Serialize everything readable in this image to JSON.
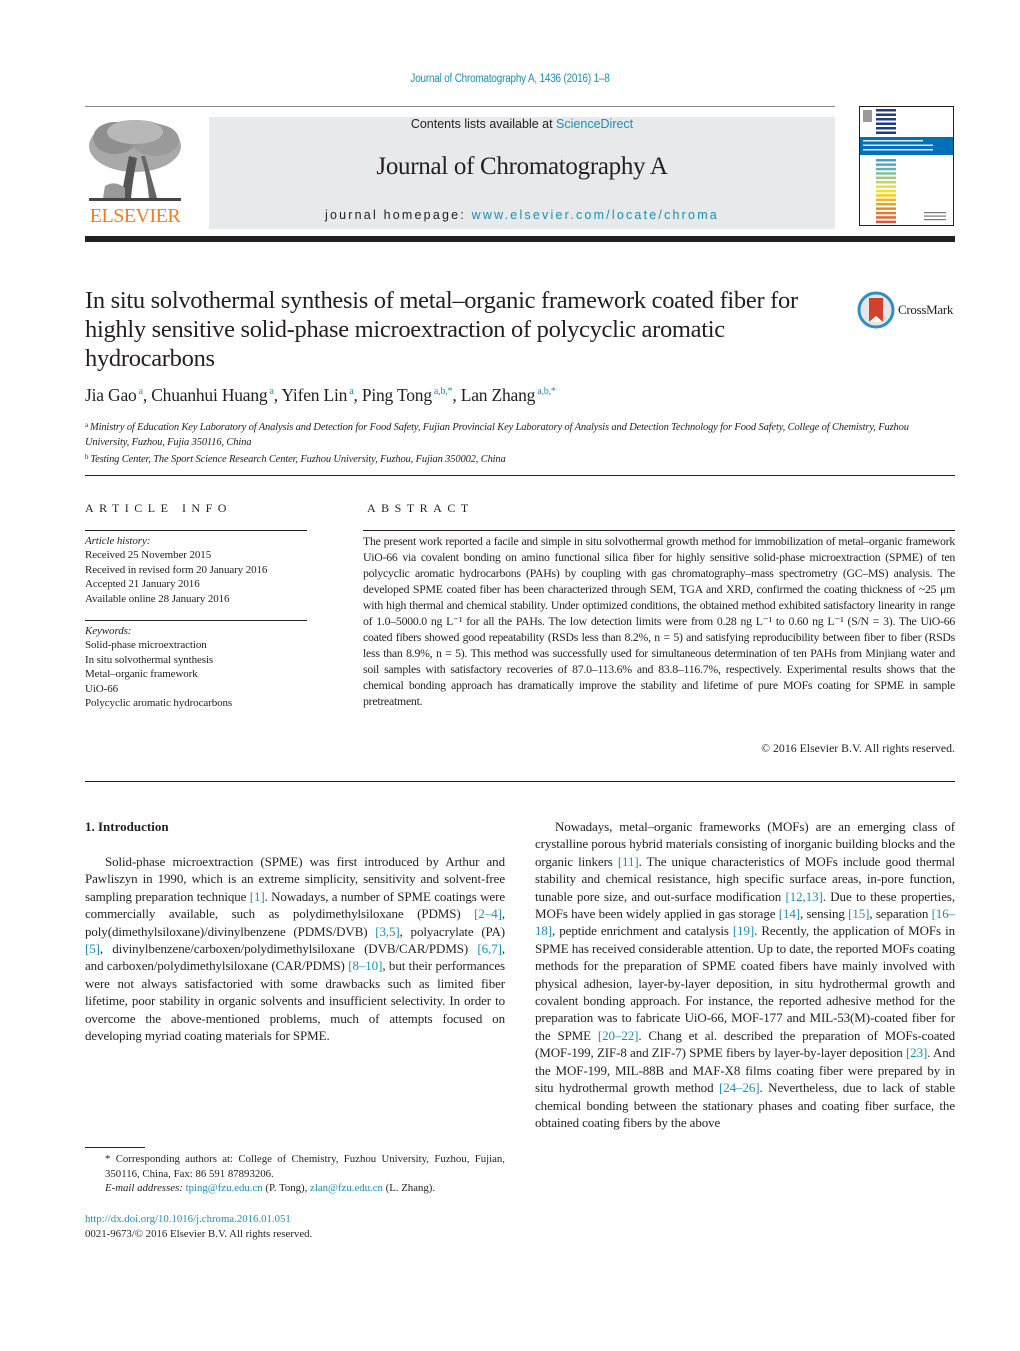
{
  "header": {
    "running_head": "Journal of Chromatography A, 1436 (2016) 1–8",
    "publisher": "ELSEVIER",
    "contents_prefix": "Contents lists available at ",
    "contents_link": "ScienceDirect",
    "journal_title": "Journal of Chromatography A",
    "homepage_prefix": "journal homepage: ",
    "homepage_link": "www.elsevier.com/locate/chroma",
    "cover_colors": [
      "#1f3b8c",
      "#1f3b8c",
      "#1f3b8c",
      "#1f3b8c",
      "#1f3b8c",
      "#1f3b8c",
      "#0071b8",
      "#3ca0d0",
      "#4aa9c5",
      "#5bb2b0",
      "#7fbf9a",
      "#a2c97e",
      "#c7d35f",
      "#e5de3e",
      "#f5e21a",
      "#f6cf14",
      "#f2b718",
      "#eba020",
      "#e38a25",
      "#de7a32",
      "#d8683a",
      "#d45a40"
    ]
  },
  "article": {
    "title": "In situ solvothermal synthesis of metal–organic framework coated fiber for highly sensitive solid-phase microextraction of polycyclic aromatic hydrocarbons",
    "crossmark_label": "CrossMark",
    "authors": [
      {
        "name": "Jia Gao",
        "sup": "a"
      },
      {
        "name": "Chuanhui Huang",
        "sup": "a"
      },
      {
        "name": "Yifen Lin",
        "sup": "a"
      },
      {
        "name": "Ping Tong",
        "sup": "a,b,*"
      },
      {
        "name": "Lan Zhang",
        "sup": "a,b,*"
      }
    ],
    "affiliations": [
      {
        "key": "a",
        "text": "Ministry of Education Key Laboratory of Analysis and Detection for Food Safety, Fujian Provincial Key Laboratory of Analysis and Detection Technology for Food Safety, College of Chemistry, Fuzhou University, Fuzhou, Fujia 350116, China"
      },
      {
        "key": "b",
        "text": "Testing Center, The Sport Science Research Center, Fuzhou University, Fuzhou, Fujian 350002, China"
      }
    ]
  },
  "article_info": {
    "heading": "ARTICLE INFO",
    "history_label": "Article history:",
    "history": [
      "Received 25 November 2015",
      "Received in revised form 20 January 2016",
      "Accepted 21 January 2016",
      "Available online 28 January 2016"
    ],
    "keywords_label": "Keywords:",
    "keywords": [
      "Solid-phase microextraction",
      "In situ solvothermal synthesis",
      "Metal–organic framework",
      "UiO-66",
      "Polycyclic aromatic hydrocarbons"
    ]
  },
  "abstract": {
    "heading": "ABSTRACT",
    "text": "The present work reported a facile and simple in situ solvothermal growth method for immobilization of metal–organic framework UiO-66 via covalent bonding on amino functional silica fiber for highly sensitive solid-phase microextraction (SPME) of ten polycyclic aromatic hydrocarbons (PAHs) by coupling with gas chromatography–mass spectrometry (GC–MS) analysis. The developed SPME coated fiber has been characterized through SEM, TGA and XRD, confirmed the coating thickness of ~25 μm with high thermal and chemical stability. Under optimized conditions, the obtained method exhibited satisfactory linearity in range of 1.0–5000.0 ng L⁻¹ for all the PAHs. The low detection limits were from 0.28 ng L⁻¹ to 0.60 ng L⁻¹ (S/N = 3). The UiO-66 coated fibers showed good repeatability (RSDs less than 8.2%, n = 5) and satisfying reproducibility between fiber to fiber (RSDs less than 8.9%, n = 5). This method was successfully used for simultaneous determination of ten PAHs from Minjiang water and soil samples with satisfactory recoveries of 87.0–113.6% and 83.8–116.7%, respectively. Experimental results shows that the chemical bonding approach has dramatically improve the stability and lifetime of pure MOFs coating for SPME in sample pretreatment.",
    "copyright": "© 2016 Elsevier B.V. All rights reserved."
  },
  "body": {
    "section_heading": "1.  Introduction",
    "left_paragraph": [
      {
        "t": "Solid-phase microextraction (SPME) was first introduced by Arthur and Pawliszyn in 1990, which is an extreme simplicity, sensitivity and solvent-free sampling preparation technique "
      },
      {
        "ref": "[1]"
      },
      {
        "t": ". Nowadays, a number of SPME coatings were commercially available, such as polydimethylsiloxane (PDMS) "
      },
      {
        "ref": "[2–4]"
      },
      {
        "t": ", poly(dimethylsiloxane)/divinylbenzene (PDMS/DVB) "
      },
      {
        "ref": "[3,5]"
      },
      {
        "t": ", polyacrylate (PA) "
      },
      {
        "ref": "[5]"
      },
      {
        "t": ", divinylbenzene/carboxen/polydimethylsiloxane (DVB/CAR/PDMS) "
      },
      {
        "ref": "[6,7]"
      },
      {
        "t": ", and carboxen/polydimethylsiloxane (CAR/PDMS) "
      },
      {
        "ref": "[8–10]"
      },
      {
        "t": ", but their performances were not always satisfactoried with some drawbacks such as limited fiber lifetime, poor stability in organic solvents and insufficient selectivity. In order to overcome the above-mentioned problems, much of attempts focused on developing myriad coating materials for SPME."
      }
    ],
    "right_paragraph": [
      {
        "t": "Nowadays, metal–organic frameworks (MOFs) are an emerging class of crystalline porous hybrid materials consisting of inorganic building blocks and the organic linkers "
      },
      {
        "ref": "[11]"
      },
      {
        "t": ". The unique characteristics of MOFs include good thermal stability and chemical resistance, high specific surface areas, in-pore function, tunable pore size, and out-surface modification "
      },
      {
        "ref": "[12,13]"
      },
      {
        "t": ". Due to these properties, MOFs have been widely applied in gas storage "
      },
      {
        "ref": "[14]"
      },
      {
        "t": ", sensing "
      },
      {
        "ref": "[15]"
      },
      {
        "t": ", separation "
      },
      {
        "ref": "[16–18]"
      },
      {
        "t": ", peptide enrichment and catalysis "
      },
      {
        "ref": "[19]"
      },
      {
        "t": ". Recently, the application of MOFs in SPME has received considerable attention. Up to date, the reported MOFs coating methods for the preparation of SPME coated fibers have mainly involved with physical adhesion, layer-by-layer deposition, in situ hydrothermal growth and covalent bonding approach. For instance, the reported adhesive method for the preparation was to fabricate UiO-66, MOF-177 and MIL-53(M)-coated fiber for the SPME "
      },
      {
        "ref": "[20–22]"
      },
      {
        "t": ". Chang et al. described the preparation of MOFs-coated (MOF-199, ZIF-8 and ZIF-7) SPME fibers by layer-by-layer deposition "
      },
      {
        "ref": "[23]"
      },
      {
        "t": ". And the MOF-199, MIL-88B and MAF-X8 films coating fiber were prepared by in situ hydrothermal growth method "
      },
      {
        "ref": "[24–26]"
      },
      {
        "t": ". Nevertheless, due to lack of stable chemical bonding between the stationary phases and coating fiber surface, the obtained coating fibers by the above"
      }
    ]
  },
  "footnotes": {
    "corresponding": "* Corresponding authors at: College of Chemistry, Fuzhou University, Fuzhou, Fujian, 350116, China, Fax: 86 591 87893206.",
    "email_label": "E-mail addresses: ",
    "emails": [
      {
        "address": "tping@fzu.edu.cn",
        "who": " (P. Tong), "
      },
      {
        "address": "zlan@fzu.edu.cn",
        "who": " (L. Zhang)."
      }
    ],
    "doi": "http://dx.doi.org/10.1016/j.chroma.2016.01.051",
    "issn_line": "0021-9673/© 2016 Elsevier B.V. All rights reserved."
  }
}
